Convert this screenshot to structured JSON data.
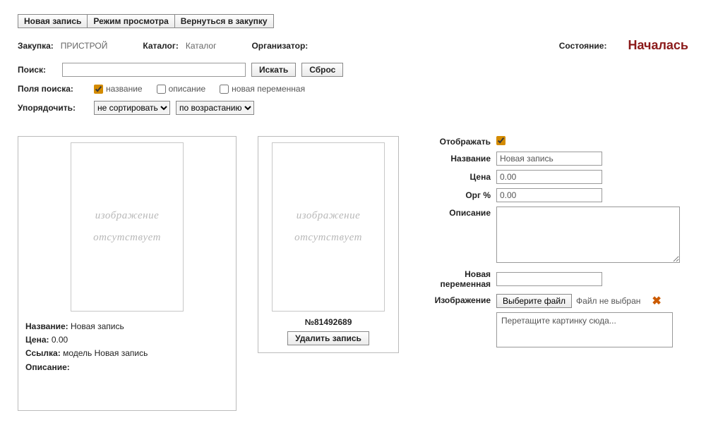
{
  "toolbar": {
    "new_record": "Новая запись",
    "view_mode": "Режим просмотра",
    "back_to_purchase": "Вернуться в закупку"
  },
  "info": {
    "purchase_label": "Закупка:",
    "purchase_value": "ПРИСТРОЙ",
    "catalog_label": "Каталог:",
    "catalog_value": "Каталог",
    "organizer_label": "Организатор:",
    "status_label": "Состояние:",
    "status_value": "Началась"
  },
  "search": {
    "label": "Поиск:",
    "value": "",
    "search_btn": "Искать",
    "reset_btn": "Сброс"
  },
  "fields": {
    "label": "Поля поиска:",
    "name": "название",
    "desc": "описание",
    "newvar": "новая переменная"
  },
  "sort": {
    "label": "Упорядочить:",
    "primary": "не сортировать",
    "secondary": "по возрастанию"
  },
  "placeholder": {
    "line1": "изображение",
    "line2": "отсутствует"
  },
  "card1": {
    "name_label": "Название:",
    "name_value": "Новая запись",
    "price_label": "Цена:",
    "price_value": "0.00",
    "link_label": "Ссылка:",
    "link_value": "модель Новая запись",
    "desc_label": "Описание:"
  },
  "card2": {
    "number": "№81492689",
    "delete_btn": "Удалить запись"
  },
  "form": {
    "show_label": "Отображать",
    "name_label": "Название",
    "name_value": "Новая запись",
    "price_label": "Цена",
    "price_value": "0.00",
    "org_label": "Орг %",
    "org_value": "0.00",
    "desc_label": "Описание",
    "newvar_label": "Новая переменная",
    "newvar_value": "",
    "image_label": "Изображение",
    "choose_file": "Выберите файл",
    "file_status": "Файл не выбран",
    "dropzone": "Перетащите картинку сюда..."
  }
}
